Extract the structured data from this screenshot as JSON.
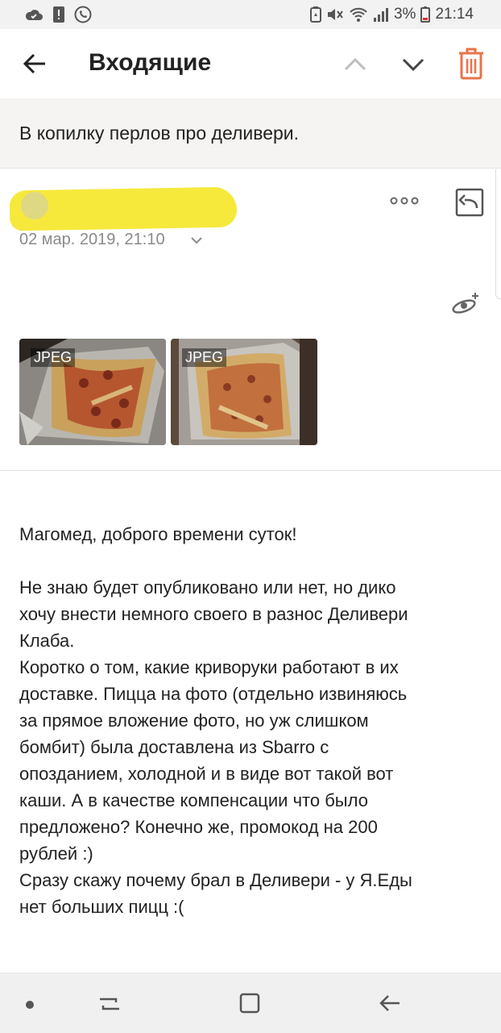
{
  "status_bar": {
    "battery": "3%",
    "time": "21:14",
    "icons": [
      "cloud-icon",
      "alert-icon",
      "call-forward-icon",
      "battery-saver-icon",
      "mute-icon",
      "wifi-icon",
      "signal-icon",
      "battery-low-icon"
    ]
  },
  "toolbar": {
    "title": "Входящие",
    "icons": [
      "back-arrow-icon",
      "chevron-up-icon",
      "chevron-down-icon",
      "trash-icon"
    ],
    "accent": "#e8734a"
  },
  "message": {
    "subject": "В копилку перлов про деливери.",
    "date": "02 мар. 2019, 21:10",
    "attachments": [
      {
        "type": "JPEG"
      },
      {
        "type": "JPEG"
      }
    ],
    "body": {
      "greeting": "Магомед, доброго времени суток!",
      "lines": [
        "Не знаю будет опубликовано или нет, но дико",
        "хочу внести немного своего в разнос Деливери",
        "Клаба.",
        "Коротко о том, какие криворуки работают в их",
        "доставке. Пицца на фото (отдельно извиняюсь",
        "за прямое вложение фото, но уж слишком",
        "бомбит) была доставлена из Sbarro с",
        "опозданием, холодной и в виде вот такой вот",
        "каши. А в качестве компенсации что было",
        "предложено? Конечно же, промокод на 200",
        "рублей :)",
        "Сразу скажу почему брал в Деливери - у Я.Еды",
        "нет больших пицц :("
      ]
    }
  },
  "nav_bar": {
    "icons": [
      "nav-dot-icon",
      "recent-apps-icon",
      "home-icon",
      "back-icon"
    ]
  }
}
